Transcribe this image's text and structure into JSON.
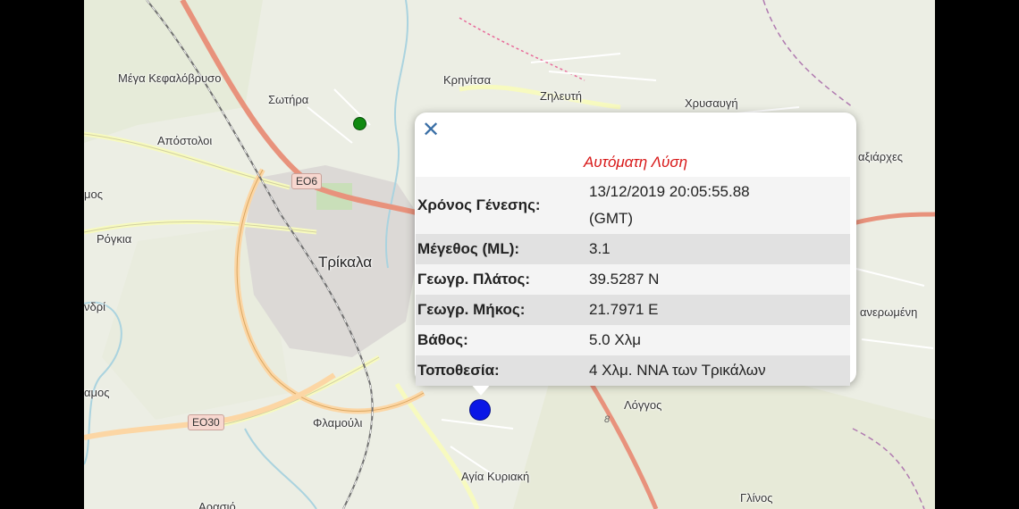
{
  "map": {
    "places": {
      "mega_kefalovryso": "Μέγα Κεφαλόβρυσο",
      "sotira": "Σωτήρα",
      "krinitsa": "Κρηνίτσα",
      "zileuti": "Ζηλευτή",
      "chrysavgi": "Χρυσαυγή",
      "apostoloi": "Απόστολοι",
      "taxiarches": "αξιάρχες",
      "mos": "μος",
      "rogkia": "Ρόγκια",
      "trikala": "Τρίκαλα",
      "andri": "νδρί",
      "anegromeni": "ανερωμένη",
      "amos": "αμος",
      "flamouli": "Φλαμούλι",
      "loggos": "Λόγγος",
      "agia_kyriaki": "Αγία Κυριακή",
      "glinos": "Γλίνος",
      "arasio": "Αρασιό"
    },
    "roads": {
      "eo6": "ΕΟ6",
      "eo30": "ΕΟ30",
      "route8": "8"
    },
    "colors": {
      "motorway": "#e8927c",
      "primary": "#fcd6a4",
      "secondary": "#f7fabf",
      "rail": "#707070",
      "water": "#aad3df"
    },
    "markers": {
      "green": "green-event-marker",
      "blue": "blue-event-marker"
    }
  },
  "popup": {
    "close": "✕",
    "title": "Αυτόματη Λύση",
    "rows": [
      {
        "label": "Χρόνος Γένεσης:",
        "value": "13/12/2019 20:05:55.88",
        "value2": "(GMT)"
      },
      {
        "label": "Μέγεθος (ML):",
        "value": "3.1"
      },
      {
        "label": "Γεωγρ. Πλάτος:",
        "value": "39.5287 N"
      },
      {
        "label": "Γεωγρ. Μήκος:",
        "value": "21.7971 E"
      },
      {
        "label": "Βάθος:",
        "value": "5.0 Χλμ"
      },
      {
        "label": "Τοποθεσία:",
        "value": "4 Χλμ. ΝΝΑ των Τρικάλων"
      }
    ]
  }
}
